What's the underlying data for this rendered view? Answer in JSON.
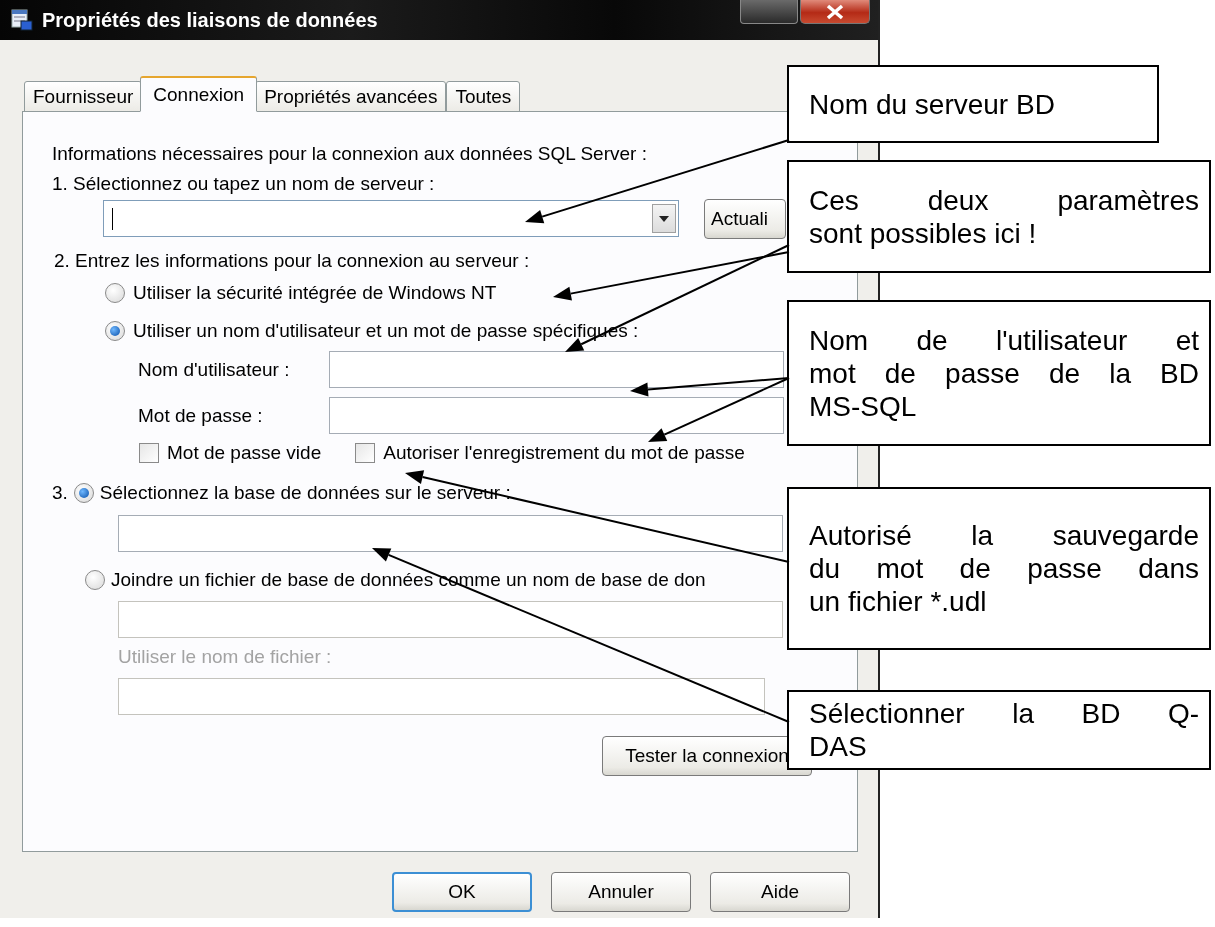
{
  "window": {
    "title": "Propriétés des liaisons de données"
  },
  "tabs": [
    {
      "label": "Fournisseur",
      "selected": false
    },
    {
      "label": "Connexion",
      "selected": true
    },
    {
      "label": "Propriétés avancées",
      "selected": false
    },
    {
      "label": "Toutes",
      "selected": false
    }
  ],
  "connection": {
    "intro": "Informations nécessaires pour la connexion aux données SQL Server :",
    "step1": {
      "label": "1. Sélectionnez ou tapez un nom de serveur :",
      "refresh_button": "Actuali"
    },
    "step2": {
      "label": "2. Entrez les informations pour la connexion au serveur :",
      "options": [
        {
          "label": "Utiliser la sécurité intégrée de Windows NT",
          "selected": false
        },
        {
          "label": "Utiliser un nom d'utilisateur et un mot de passe spécifiques :",
          "selected": true
        }
      ],
      "username_label": "Nom d'utilisateur :",
      "password_label": "Mot de passe :",
      "checkboxes": [
        {
          "label": "Mot de passe vide",
          "checked": false
        },
        {
          "label": "Autoriser l'enregistrement du mot de passe",
          "checked": false
        }
      ]
    },
    "step3": {
      "number": "3.",
      "options": [
        {
          "label": "Sélectionnez la base de données sur le serveur :",
          "selected": true
        },
        {
          "label": "Joindre un fichier de base de données comme un nom de base de don",
          "selected": false
        }
      ],
      "filename_label": "Utiliser le nom de fichier :",
      "filename_disabled": true
    },
    "test_button": "Tester la connexion"
  },
  "buttons": [
    {
      "label": "OK",
      "default": true
    },
    {
      "label": "Annuler",
      "default": false
    },
    {
      "label": "Aide",
      "default": false
    }
  ],
  "callouts": [
    {
      "lines": [
        "Nom du serveur BD"
      ]
    },
    {
      "lines": [
        "Ces deux paramètres",
        "sont possibles ici !"
      ]
    },
    {
      "lines": [
        "Nom de l'utilisateur  et",
        "mot de passe de la BD",
        "MS-SQL"
      ]
    },
    {
      "lines": [
        "Autorisé la sauvegarde",
        "du mot de passe dans",
        "un fichier *.udl"
      ]
    },
    {
      "lines": [
        "Sélectionner la BD Q-",
        "DAS"
      ]
    }
  ]
}
